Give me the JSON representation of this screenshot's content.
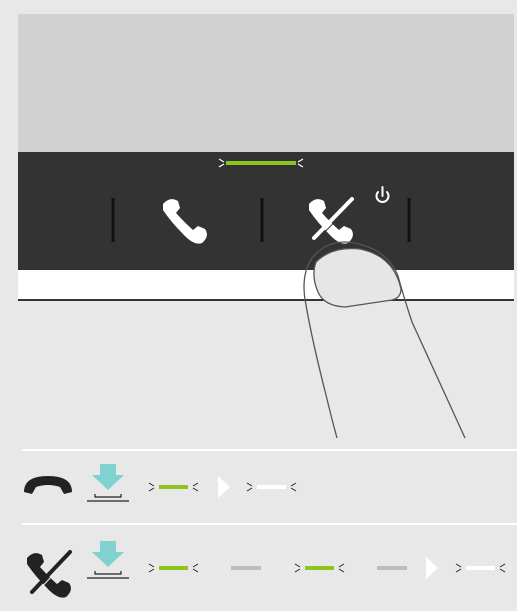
{
  "colors": {
    "background": "#e8e8e8",
    "device_top": "#d0d1d0",
    "device_panel": "#333333",
    "device_strip": "#ffffff",
    "led_green": "#8dc41f",
    "led_white": "#ffffff",
    "led_off": "#bdbdbd",
    "arrow": "#7fd2d0",
    "icon_dark": "#222222",
    "finger_fill": "#e6e6e6",
    "finger_stroke": "#555555"
  },
  "icons": {
    "answer": "phone-handset-icon",
    "end_power": "phone-hangup-power-icon",
    "power": "power-icon",
    "press": "press-down-arrow-icon"
  },
  "rows": [
    {
      "name": "row-end-call",
      "icon": "phone-receiver-icon",
      "leds": [
        "green-blink",
        "arrow",
        "white-blink"
      ]
    },
    {
      "name": "row-power-off",
      "icon": "phone-hangup-icon",
      "leds": [
        "green-blink",
        "off",
        "green-blink",
        "off",
        "arrow",
        "white-blink"
      ]
    }
  ]
}
